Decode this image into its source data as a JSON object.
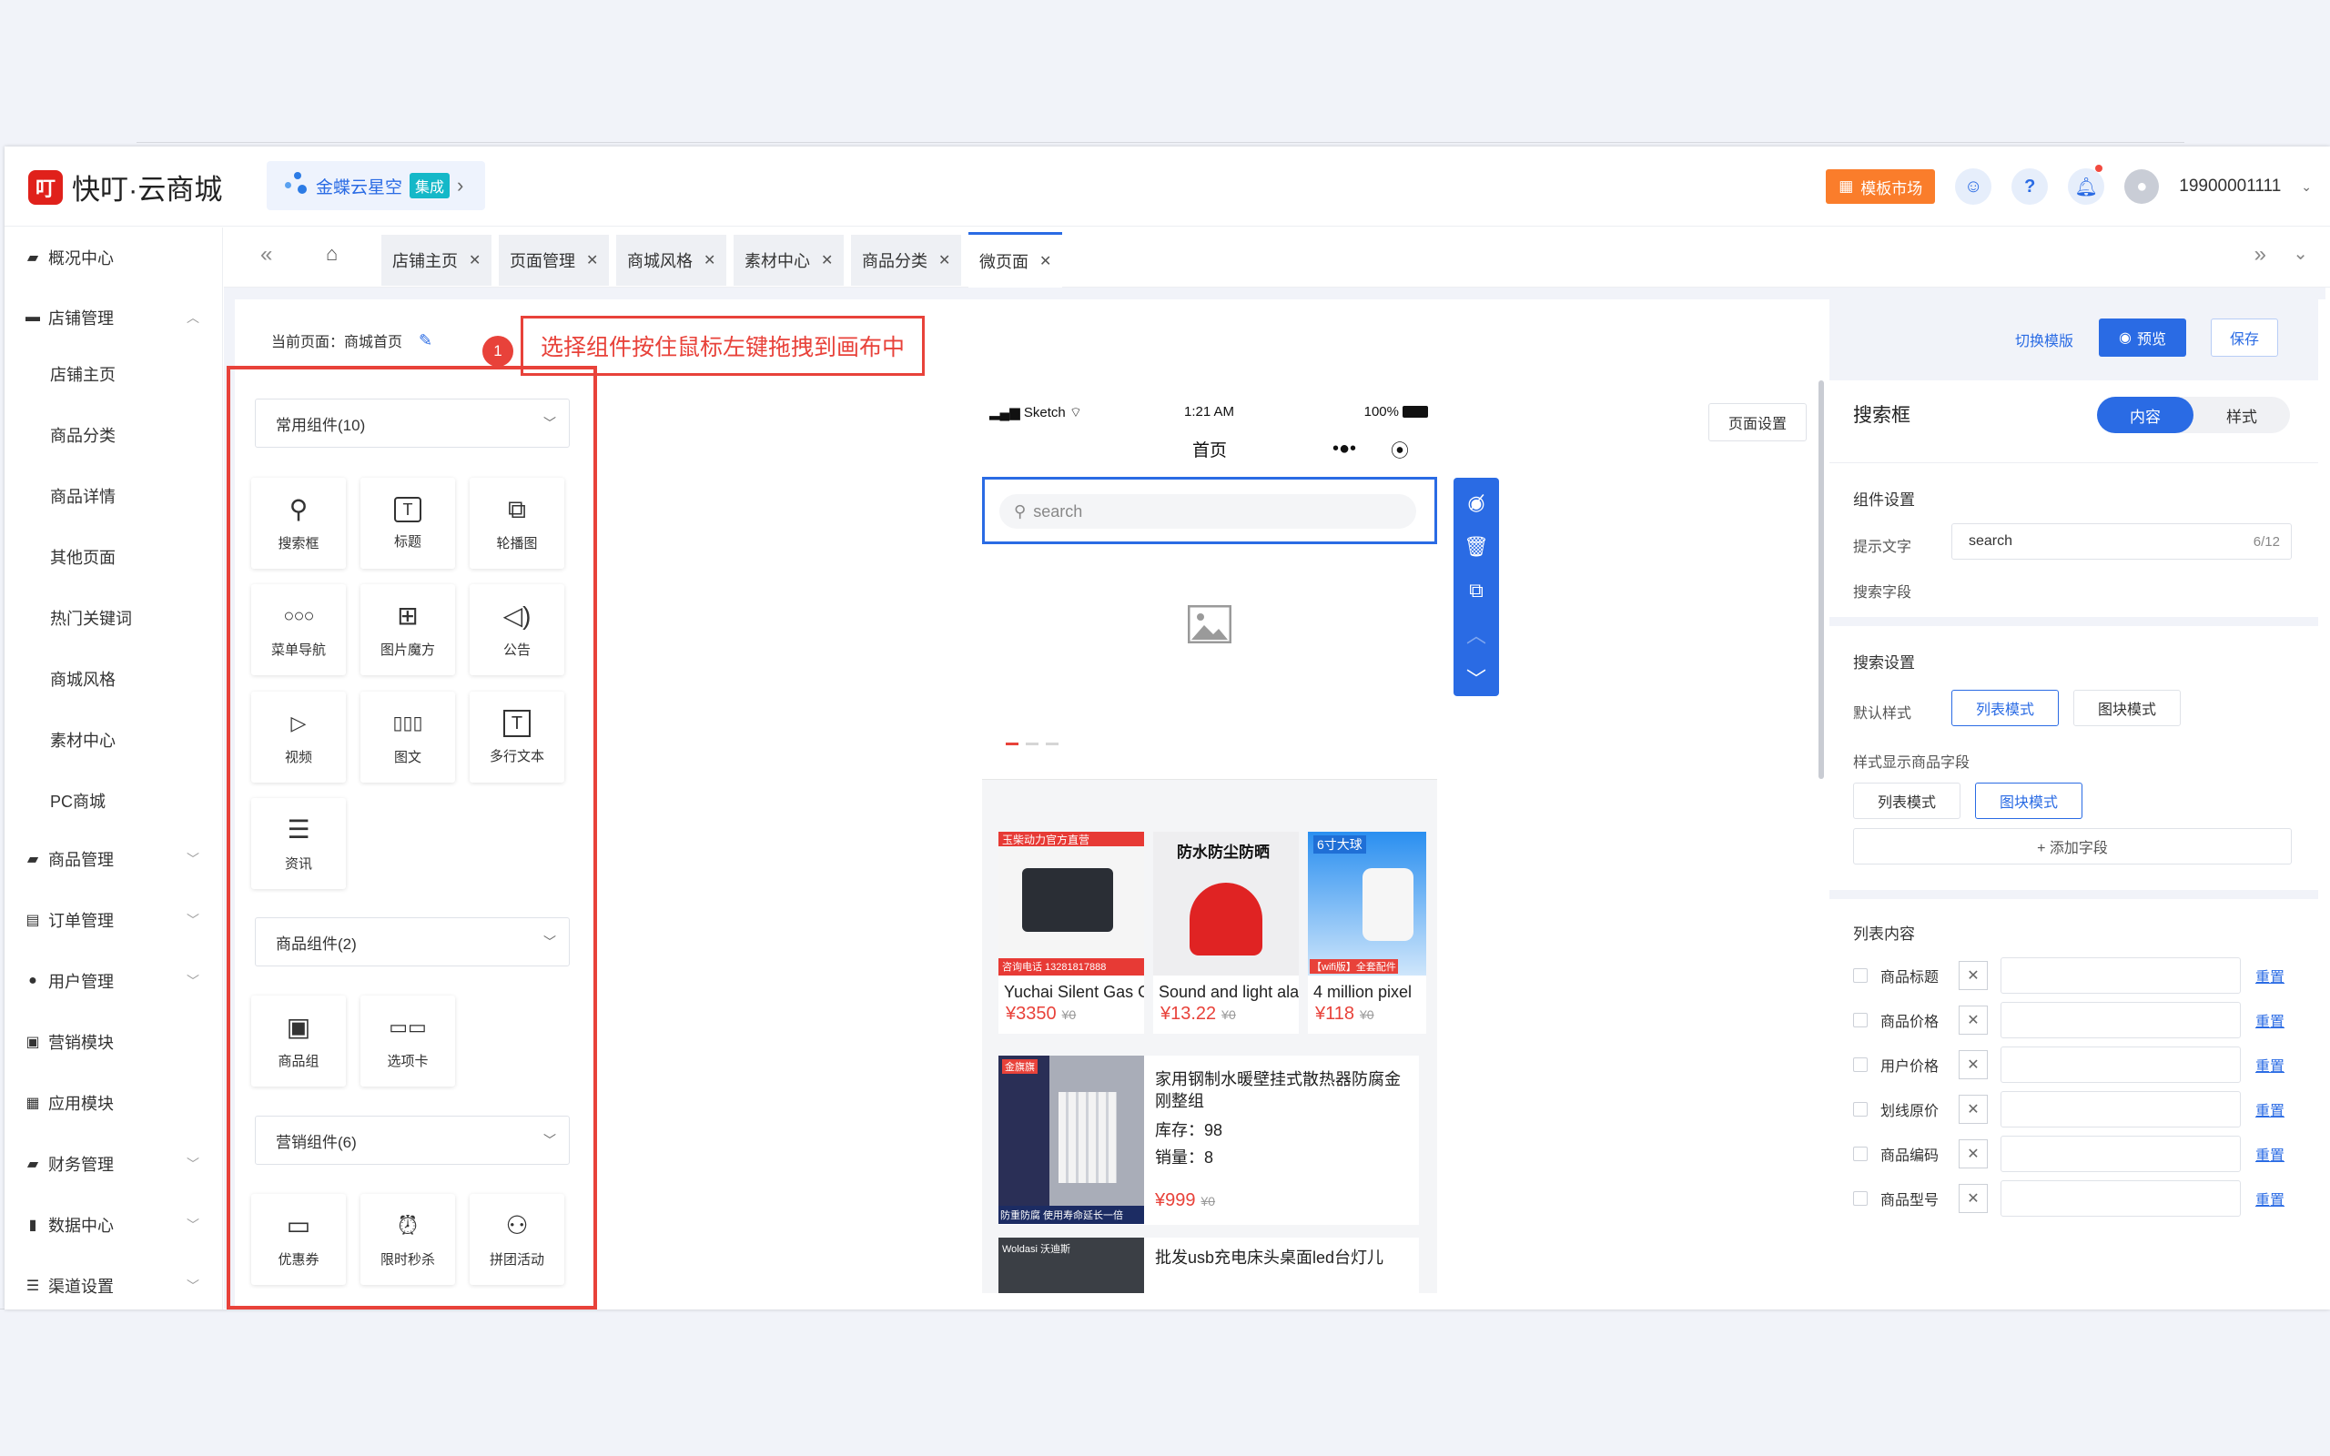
{
  "header": {
    "logo_mark": "叮",
    "logo_text": "快叮·云商城",
    "kingdee": {
      "label": "金蝶云星空",
      "tag": "集成",
      "arrow": "›"
    },
    "template_market": "模板市场",
    "username": "19900001111"
  },
  "sidebar": {
    "items": [
      {
        "label": "概况中心",
        "icon": "dashboard-icon"
      },
      {
        "label": "店铺管理",
        "icon": "store-icon",
        "expanded": true
      },
      {
        "label": "商品管理",
        "icon": "goods-icon"
      },
      {
        "label": "订单管理",
        "icon": "order-icon"
      },
      {
        "label": "用户管理",
        "icon": "user-icon"
      },
      {
        "label": "营销模块",
        "icon": "marketing-icon"
      },
      {
        "label": "应用模块",
        "icon": "apps-icon"
      },
      {
        "label": "财务管理",
        "icon": "finance-icon"
      },
      {
        "label": "数据中心",
        "icon": "data-icon"
      },
      {
        "label": "渠道设置",
        "icon": "channel-icon"
      }
    ],
    "subitems": [
      "店铺主页",
      "商品分类",
      "商品详情",
      "其他页面",
      "热门关键词",
      "商城风格",
      "素材中心",
      "PC商城"
    ]
  },
  "tabs": [
    {
      "label": "店铺主页"
    },
    {
      "label": "页面管理"
    },
    {
      "label": "商城风格"
    },
    {
      "label": "素材中心"
    },
    {
      "label": "商品分类"
    },
    {
      "label": "微页面",
      "active": true
    }
  ],
  "editor": {
    "current_page": "当前页面：商城首页",
    "step_number": "1",
    "hint": "选择组件按住鼠标左键拖拽到画布中",
    "switch_template": "切换模版",
    "preview": "预览",
    "save": "保存",
    "page_settings": "页面设置"
  },
  "components": {
    "common": {
      "title": "常用组件(10)",
      "items": [
        {
          "label": "搜索框",
          "icon": "search-icon"
        },
        {
          "label": "标题",
          "icon": "title-icon"
        },
        {
          "label": "轮播图",
          "icon": "carousel-icon"
        },
        {
          "label": "菜单导航",
          "icon": "menu-nav-icon"
        },
        {
          "label": "图片魔方",
          "icon": "image-cube-icon"
        },
        {
          "label": "公告",
          "icon": "announcement-icon"
        },
        {
          "label": "视频",
          "icon": "video-icon"
        },
        {
          "label": "图文",
          "icon": "image-text-icon"
        },
        {
          "label": "多行文本",
          "icon": "multiline-text-icon"
        },
        {
          "label": "资讯",
          "icon": "news-icon"
        }
      ]
    },
    "goods": {
      "title": "商品组件(2)",
      "items": [
        {
          "label": "商品组",
          "icon": "goods-group-icon"
        },
        {
          "label": "选项卡",
          "icon": "tabs-icon"
        }
      ]
    },
    "marketing": {
      "title": "营销组件(6)",
      "items": [
        {
          "label": "优惠券",
          "icon": "coupon-icon"
        },
        {
          "label": "限时秒杀",
          "icon": "flash-sale-icon"
        },
        {
          "label": "拼团活动",
          "icon": "group-buy-icon"
        }
      ]
    }
  },
  "phone": {
    "carrier": "Sketch",
    "time": "1:21 AM",
    "battery": "100%",
    "nav_title": "首页",
    "search_placeholder": "search",
    "products": [
      {
        "name": "Yuchai Silent Gas Generator",
        "price": "¥3350",
        "orig": "¥0",
        "banner": "玉柴动力官方直营",
        "banner2": "咨询电话 13281817888"
      },
      {
        "name": "Sound and light alarm",
        "price": "¥13.22",
        "orig": "¥0",
        "banner": "防水防尘防晒"
      },
      {
        "name": "4 million pixel",
        "price": "¥118",
        "orig": "¥0",
        "banner": "6寸大球",
        "banner2": "【wifi版】全套配件"
      }
    ],
    "list_items": [
      {
        "title": "家用钢制水暖壁挂式散热器防腐金刚整组",
        "stock": "库存：98",
        "sales": "销量：8",
        "price": "¥999",
        "orig": "¥0",
        "img_top": "金旗旗",
        "img_bottom": "防重防腐 使用寿命延长一倍"
      },
      {
        "title": "批发usb充电床头桌面led台灯儿",
        "img_top": "Woldasi 沃迪斯"
      }
    ]
  },
  "right_panel": {
    "title": "搜索框",
    "seg_content": "内容",
    "seg_style": "样式",
    "component_settings": "组件设置",
    "hint_text_label": "提示文字",
    "hint_text_value": "search",
    "hint_count": "6/12",
    "search_field_label": "搜索字段",
    "search_settings": "搜索设置",
    "default_style_label": "默认样式",
    "list_mode": "列表模式",
    "block_mode": "图块模式",
    "style_fields_label": "样式显示商品字段",
    "add_field": "+ 添加字段",
    "list_content": "列表内容",
    "fields": [
      "商品标题",
      "商品价格",
      "用户价格",
      "划线原价",
      "商品编码",
      "商品型号"
    ],
    "reset": "重置"
  },
  "colors": {
    "primary": "#2a6be4",
    "annotation": "#e8423a",
    "logo": "#e0211b",
    "template_btn": "#fa7d2b",
    "price": "#e8423a"
  }
}
